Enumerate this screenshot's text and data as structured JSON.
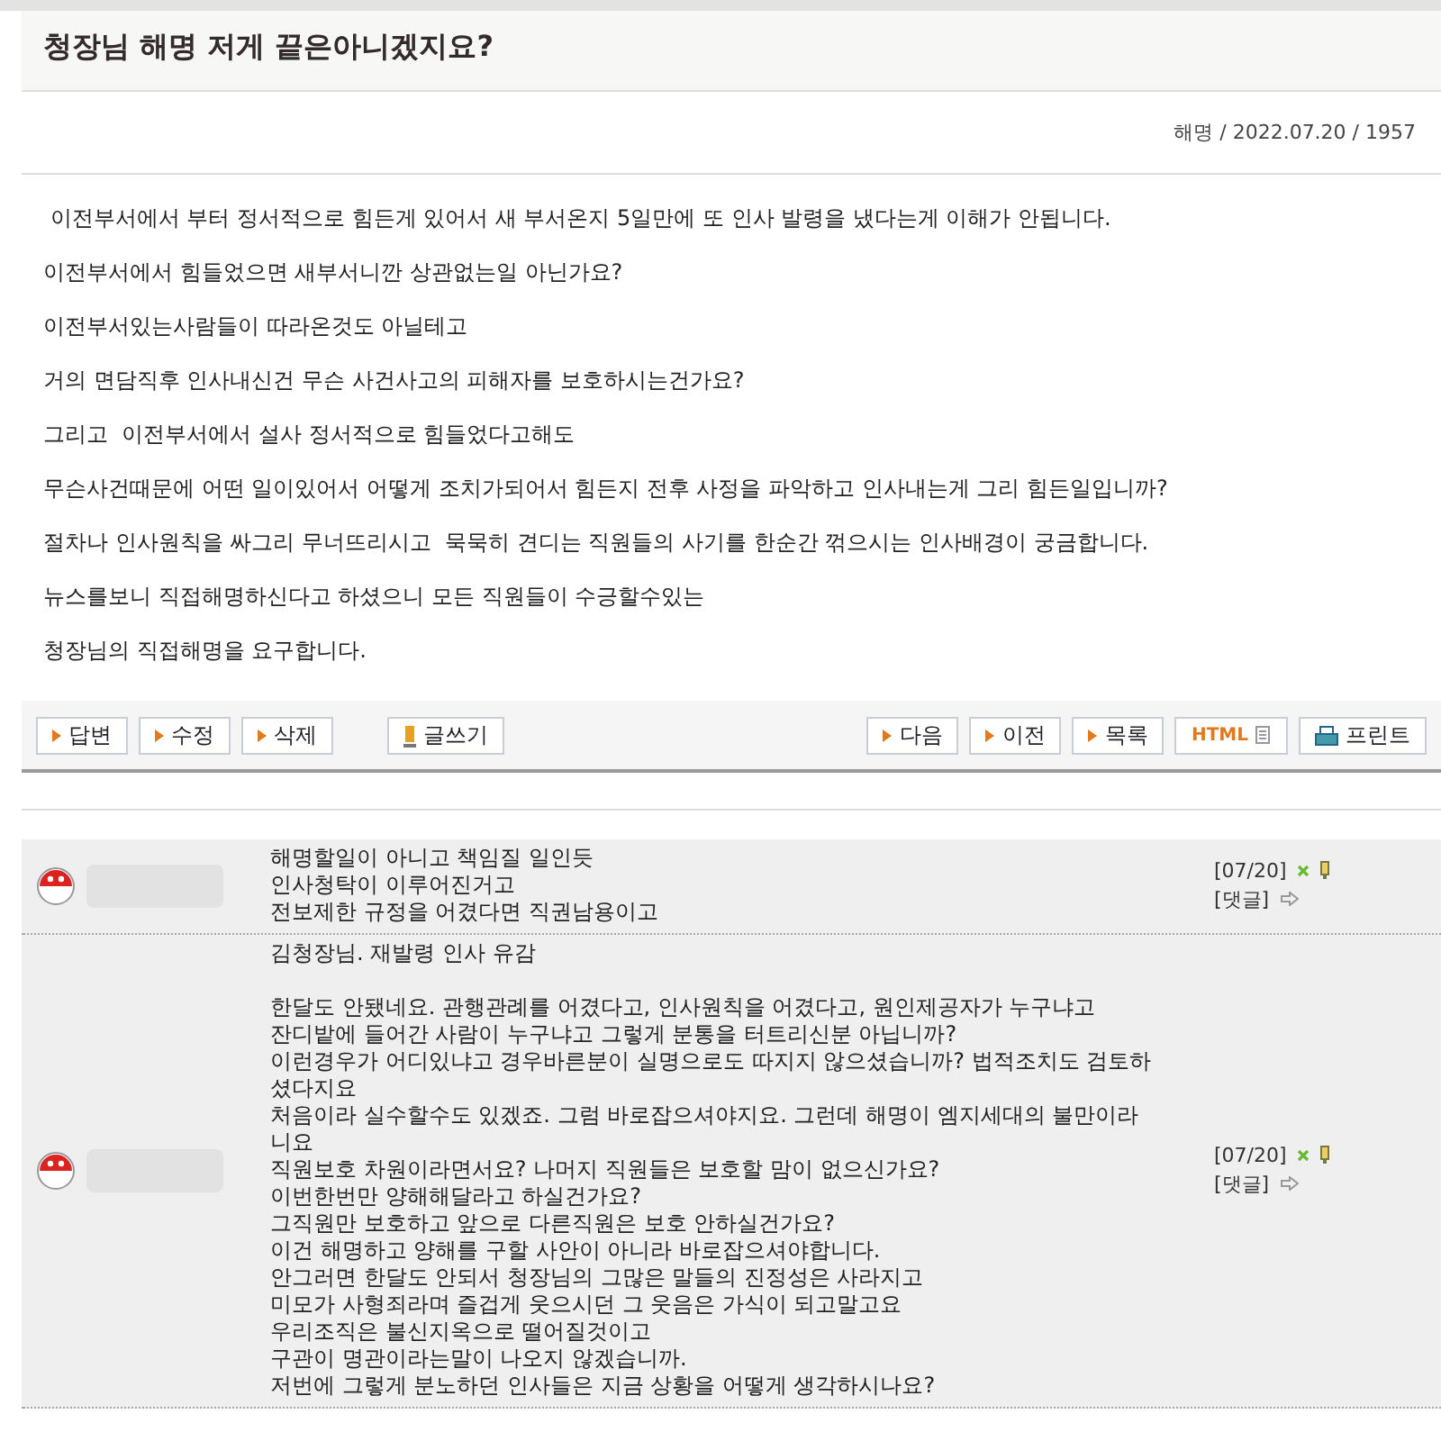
{
  "post": {
    "title": "청장님 해명 저게 끝은아니겠지요?",
    "meta": "해명 / 2022.07.20 / 1957",
    "paragraphs": [
      " 이전부서에서 부터 정서적으로 힘든게 있어서 새 부서온지 5일만에 또 인사 발령을 냈다는게 이해가 안됩니다.",
      "이전부서에서 힘들었으면 새부서니깐 상관없는일 아닌가요?",
      "이전부서있는사람들이 따라온것도 아닐테고",
      "거의 면담직후 인사내신건 무슨 사건사고의 피해자를 보호하시는건가요?",
      "그리고  이전부서에서 설사 정서적으로 힘들었다고해도",
      "무슨사건때문에 어떤 일이있어서 어떻게 조치가되어서 힘든지 전후 사정을 파악하고 인사내는게 그리 힘든일입니까?",
      "절차나 인사원칙을 싸그리 무너뜨리시고  묵묵히 견디는 직원들의 사기를 한순간 꺾으시는 인사배경이 궁금합니다.",
      "뉴스를보니 직접해명하신다고 하셨으니 모든 직원들이 수긍할수있는",
      "청장님의 직접해명을 요구합니다."
    ]
  },
  "toolbar": {
    "left": [
      {
        "kind": "arrow",
        "label": "답변"
      },
      {
        "kind": "arrow",
        "label": "수정"
      },
      {
        "kind": "arrow",
        "label": "삭제"
      },
      {
        "kind": "write",
        "label": "글쓰기"
      }
    ],
    "right": [
      {
        "kind": "arrow",
        "label": "다음"
      },
      {
        "kind": "arrow",
        "label": "이전"
      },
      {
        "kind": "arrow",
        "label": "목록"
      },
      {
        "kind": "html",
        "label": "HTML"
      },
      {
        "kind": "print",
        "label": "프린트"
      }
    ]
  },
  "comments": [
    {
      "date": "[07/20]",
      "reply": "[댓글]",
      "lines": [
        "해명할일이 아니고 책임질 일인듯",
        "인사청탁이 이루어진거고",
        "전보제한 규정을 어겼다면 직권남용이고"
      ]
    },
    {
      "date": "[07/20]",
      "reply": "[댓글]",
      "heading": "김청장님. 재발령 인사 유감",
      "lines": [
        "한달도 안됐네요. 관행관례를 어겼다고, 인사원칙을 어겼다고, 원인제공자가 누구냐고",
        "잔디밭에 들어간 사람이 누구냐고 그렇게 분통을 터트리신분 아닙니까?",
        "이런경우가 어디있냐고 경우바른분이 실명으로도 따지지 않으셨습니까? 법적조치도 검토하",
        "셨다지요",
        "처음이라 실수할수도 있겠죠. 그럼 바로잡으셔야지요. 그런데 해명이 엠지세대의 불만이라",
        "니요",
        "직원보호 차원이라면서요? 나머지 직원들은 보호할 맘이 없으신가요?",
        "이번한번만 양해해달라고 하실건가요?",
        "그직원만 보호하고 앞으로 다른직원은 보호 안하실건가요?",
        "이건 해명하고 양해를 구할 사안이 아니라 바로잡으셔야합니다.",
        "안그러면 한달도 안되서 청장님의 그많은 말들의 진정성은 사라지고",
        "미모가 사형죄라며 즐겁게 웃으시던 그 웃음은 가식이 되고말고요",
        "우리조직은 불신지옥으로 떨어질것이고",
        "구관이 명관이라는말이 나오지 않겠습니까.",
        "저번에 그렇게 분노하던 인사들은 지금 상황을 어떻게 생각하시나요?"
      ]
    }
  ]
}
